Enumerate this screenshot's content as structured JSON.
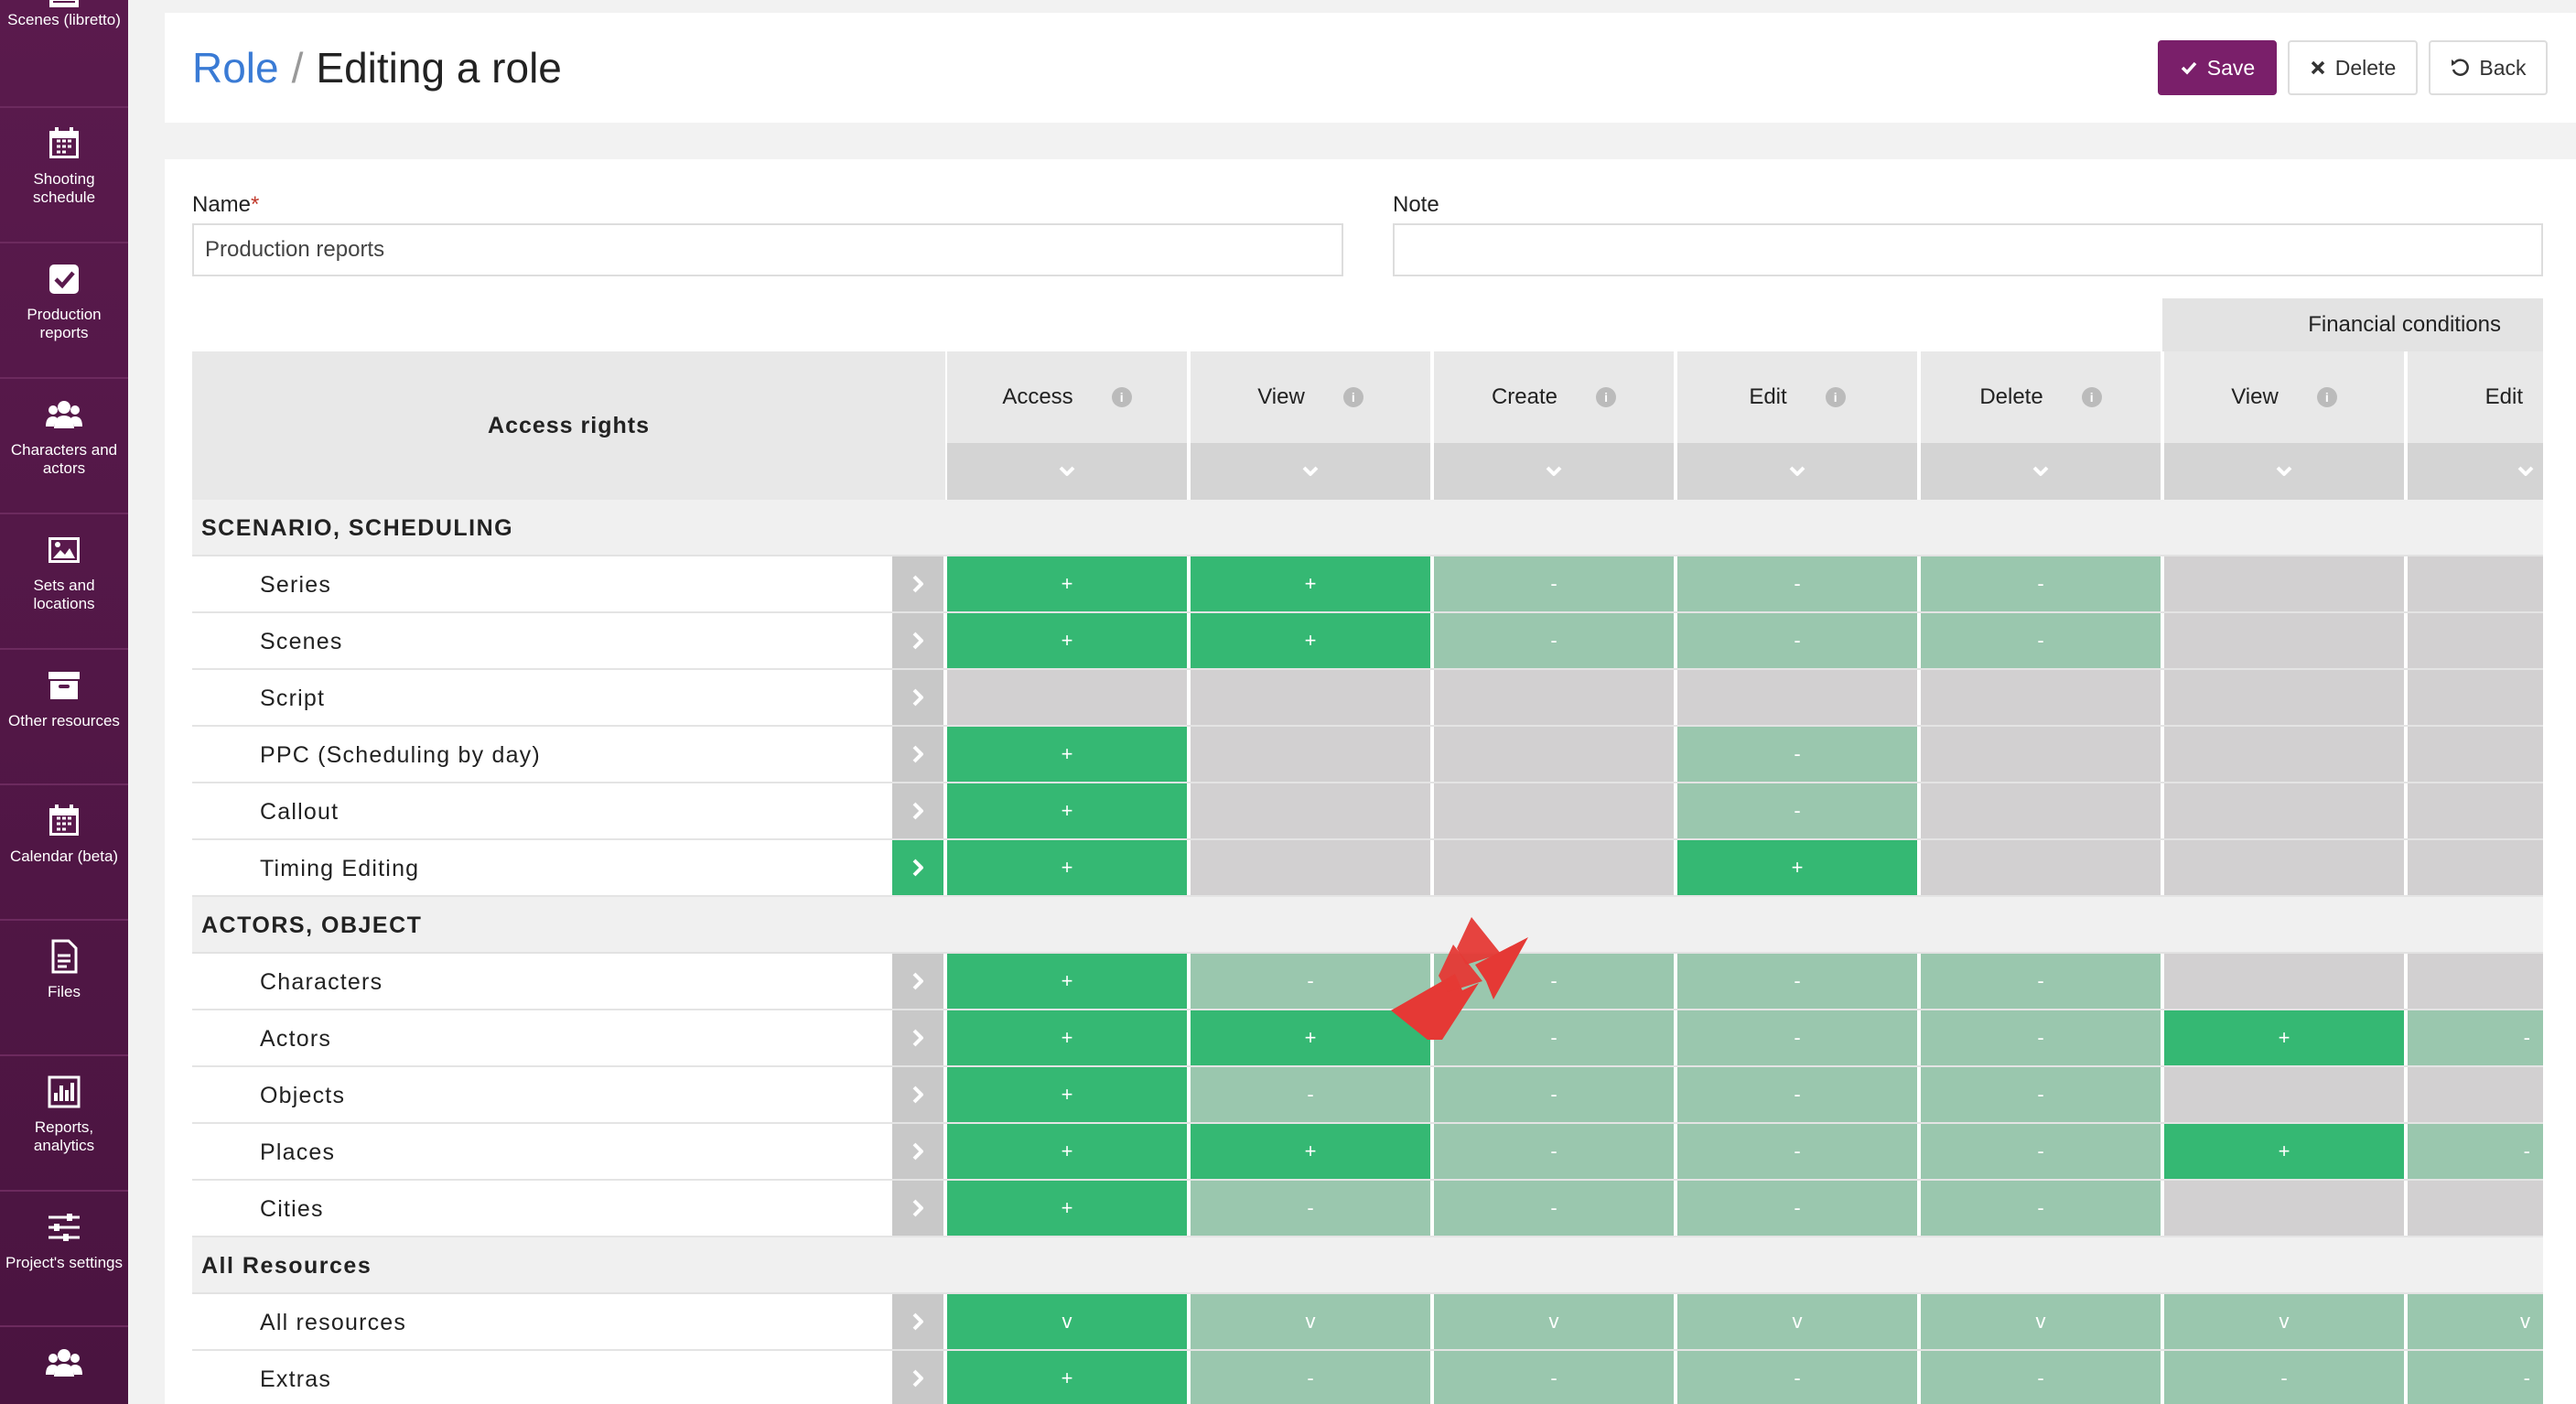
{
  "sidebar": {
    "items": [
      {
        "label": "Scenes (libretto)",
        "icon": "clapperboard-icon",
        "name": "sidebar-item-scenes"
      },
      {
        "label": "Shooting schedule",
        "icon": "calendar-grid-icon",
        "name": "sidebar-item-shooting-schedule"
      },
      {
        "label": "Production reports",
        "icon": "check-square-icon",
        "name": "sidebar-item-production-reports"
      },
      {
        "label": "Characters and actors",
        "icon": "users-icon",
        "name": "sidebar-item-characters-actors"
      },
      {
        "label": "Sets and locations",
        "icon": "image-icon",
        "name": "sidebar-item-sets-locations"
      },
      {
        "label": "Other resources",
        "icon": "archive-icon",
        "name": "sidebar-item-other-resources"
      },
      {
        "label": "Calendar (beta)",
        "icon": "calendar-icon",
        "name": "sidebar-item-calendar"
      },
      {
        "label": "Files",
        "icon": "file-icon",
        "name": "sidebar-item-files"
      },
      {
        "label": "Reports, analytics",
        "icon": "bar-chart-icon",
        "name": "sidebar-item-reports"
      },
      {
        "label": "Project's settings",
        "icon": "sliders-icon",
        "name": "sidebar-item-settings"
      },
      {
        "label": "",
        "icon": "users-icon",
        "name": "sidebar-item-roles"
      }
    ]
  },
  "header": {
    "breadcrumb_root": "Role",
    "separator": "/",
    "title": "Editing a role",
    "save_label": "Save",
    "delete_label": "Delete",
    "back_label": "Back"
  },
  "form": {
    "name_label": "Name",
    "required_mark": "*",
    "name_value": "Production reports",
    "note_label": "Note",
    "note_value": ""
  },
  "table": {
    "group_header": "Financial conditions",
    "left_header": "Access rights",
    "columns": [
      "Access",
      "View",
      "Create",
      "Edit",
      "Delete",
      "View",
      "Edit"
    ],
    "sections": [
      {
        "title": "SCENARIO, SCHEDULING",
        "rows": [
          {
            "name": "Series",
            "active": false,
            "cells": [
              [
                "g",
                "+"
              ],
              [
                "g",
                "+"
              ],
              [
                "l",
                "-"
              ],
              [
                "l",
                "-"
              ],
              [
                "l",
                "-"
              ],
              [
                "x",
                ""
              ],
              [
                "x",
                ""
              ]
            ]
          },
          {
            "name": "Scenes",
            "active": false,
            "cells": [
              [
                "g",
                "+"
              ],
              [
                "g",
                "+"
              ],
              [
                "l",
                "-"
              ],
              [
                "l",
                "-"
              ],
              [
                "l",
                "-"
              ],
              [
                "x",
                ""
              ],
              [
                "x",
                ""
              ]
            ]
          },
          {
            "name": "Script",
            "active": false,
            "cells": [
              [
                "x",
                ""
              ],
              [
                "x",
                ""
              ],
              [
                "x",
                ""
              ],
              [
                "x",
                ""
              ],
              [
                "x",
                ""
              ],
              [
                "x",
                ""
              ],
              [
                "x",
                ""
              ]
            ]
          },
          {
            "name": "PPC (Scheduling by day)",
            "active": false,
            "cells": [
              [
                "g",
                "+"
              ],
              [
                "x",
                ""
              ],
              [
                "x",
                ""
              ],
              [
                "l",
                "-"
              ],
              [
                "x",
                ""
              ],
              [
                "x",
                ""
              ],
              [
                "x",
                ""
              ]
            ]
          },
          {
            "name": "Callout",
            "active": false,
            "cells": [
              [
                "g",
                "+"
              ],
              [
                "x",
                ""
              ],
              [
                "x",
                ""
              ],
              [
                "l",
                "-"
              ],
              [
                "x",
                ""
              ],
              [
                "x",
                ""
              ],
              [
                "x",
                ""
              ]
            ]
          },
          {
            "name": "Timing Editing",
            "active": true,
            "cells": [
              [
                "g",
                "+"
              ],
              [
                "x",
                ""
              ],
              [
                "x",
                ""
              ],
              [
                "g",
                "+"
              ],
              [
                "x",
                ""
              ],
              [
                "x",
                ""
              ],
              [
                "x",
                ""
              ]
            ]
          }
        ]
      },
      {
        "title": "ACTORS, OBJECT",
        "rows": [
          {
            "name": "Characters",
            "active": false,
            "cells": [
              [
                "g",
                "+"
              ],
              [
                "l",
                "-"
              ],
              [
                "l",
                "-"
              ],
              [
                "l",
                "-"
              ],
              [
                "l",
                "-"
              ],
              [
                "x",
                ""
              ],
              [
                "x",
                ""
              ]
            ]
          },
          {
            "name": "Actors",
            "active": false,
            "cells": [
              [
                "g",
                "+"
              ],
              [
                "g",
                "+"
              ],
              [
                "l",
                "-"
              ],
              [
                "l",
                "-"
              ],
              [
                "l",
                "-"
              ],
              [
                "g",
                "+"
              ],
              [
                "l",
                "-"
              ]
            ]
          },
          {
            "name": "Objects",
            "active": false,
            "cells": [
              [
                "g",
                "+"
              ],
              [
                "l",
                "-"
              ],
              [
                "l",
                "-"
              ],
              [
                "l",
                "-"
              ],
              [
                "l",
                "-"
              ],
              [
                "x",
                ""
              ],
              [
                "x",
                ""
              ]
            ]
          },
          {
            "name": "Places",
            "active": false,
            "cells": [
              [
                "g",
                "+"
              ],
              [
                "g",
                "+"
              ],
              [
                "l",
                "-"
              ],
              [
                "l",
                "-"
              ],
              [
                "l",
                "-"
              ],
              [
                "g",
                "+"
              ],
              [
                "l",
                "-"
              ]
            ]
          },
          {
            "name": "Cities",
            "active": false,
            "cells": [
              [
                "g",
                "+"
              ],
              [
                "l",
                "-"
              ],
              [
                "l",
                "-"
              ],
              [
                "l",
                "-"
              ],
              [
                "l",
                "-"
              ],
              [
                "x",
                ""
              ],
              [
                "x",
                ""
              ]
            ]
          }
        ]
      },
      {
        "title": "All Resources",
        "rows": [
          {
            "name": "All resources",
            "active": false,
            "cells": [
              [
                "g",
                "v"
              ],
              [
                "l",
                "v"
              ],
              [
                "l",
                "v"
              ],
              [
                "l",
                "v"
              ],
              [
                "l",
                "v"
              ],
              [
                "l",
                "v"
              ],
              [
                "l",
                "v"
              ]
            ]
          },
          {
            "name": "Extras",
            "active": false,
            "cells": [
              [
                "g",
                "+"
              ],
              [
                "l",
                "-"
              ],
              [
                "l",
                "-"
              ],
              [
                "l",
                "-"
              ],
              [
                "l",
                "-"
              ],
              [
                "l",
                "-"
              ],
              [
                "l",
                "-"
              ]
            ]
          }
        ]
      }
    ]
  },
  "colors": {
    "sidebar": "#5a1a4d",
    "accent": "#7a1f6a",
    "link": "#3a7bd5",
    "granted": "#35b873",
    "inherited": "#9ac7ae",
    "disabled": "#d2d0d1",
    "annotation": "#e53935"
  }
}
